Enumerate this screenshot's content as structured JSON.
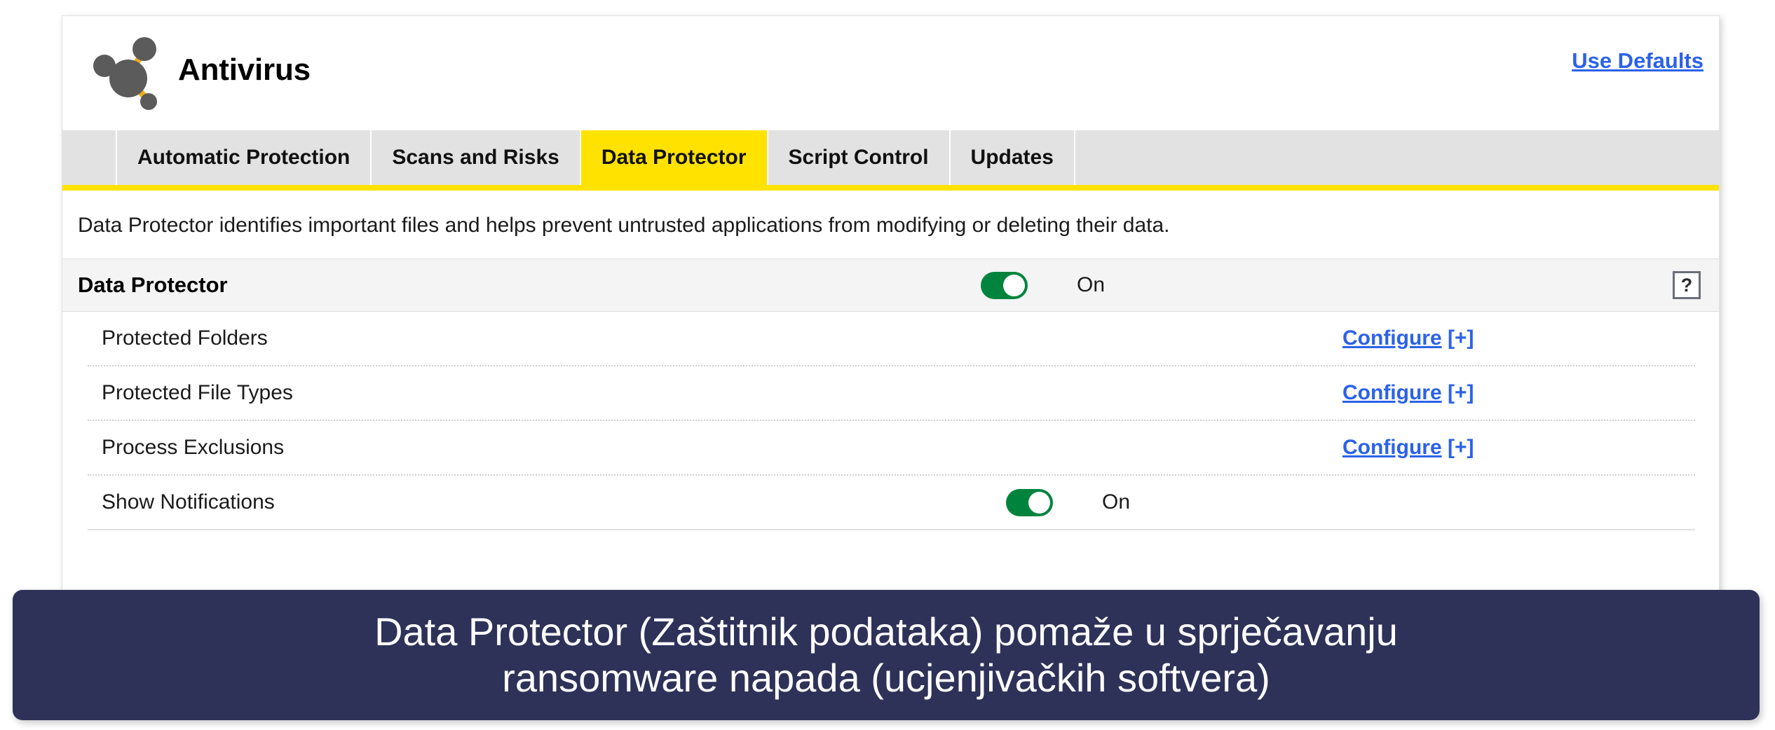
{
  "header": {
    "app_title": "Antivirus",
    "logo_icon": "molecule-icon",
    "use_defaults_label": "Use Defaults"
  },
  "tabs": [
    {
      "label": "Automatic Protection",
      "active": false
    },
    {
      "label": "Scans and Risks",
      "active": false
    },
    {
      "label": "Data Protector",
      "active": true
    },
    {
      "label": "Script Control",
      "active": false
    },
    {
      "label": "Updates",
      "active": false
    }
  ],
  "description": "Data Protector identifies important files and helps prevent untrusted applications from modifying or deleting their data.",
  "section": {
    "title": "Data Protector",
    "toggle_state": "On",
    "help_glyph": "?"
  },
  "settings": [
    {
      "label": "Protected Folders",
      "action": "Configure",
      "action_suffix": " [+]"
    },
    {
      "label": "Protected File Types",
      "action": "Configure",
      "action_suffix": " [+]"
    },
    {
      "label": "Process Exclusions",
      "action": "Configure",
      "action_suffix": " [+]"
    },
    {
      "label": "Show Notifications",
      "toggle_state": "On"
    }
  ],
  "caption": {
    "line1": "Data Protector (Zaštitnik podataka) pomaže u sprječavanju",
    "line2": "ransomware napada (ucjenjivačkih softvera)"
  },
  "colors": {
    "accent_yellow": "#ffe200",
    "link_blue": "#2b62e8",
    "toggle_green": "#00843d",
    "tab_gray": "#e2e2e2",
    "banner_navy": "#2e3259"
  }
}
